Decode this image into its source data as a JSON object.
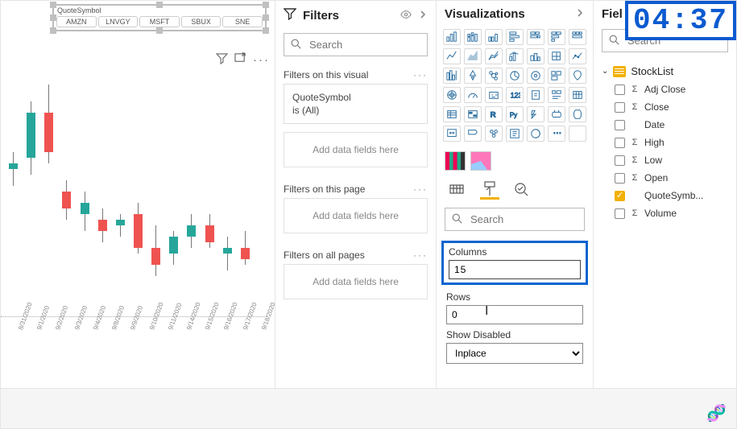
{
  "timer": "04:37",
  "slicer": {
    "title": "QuoteSymbol",
    "chips": [
      "AMZN",
      "LNVGY",
      "MSFT",
      "SBUX",
      "SNE"
    ]
  },
  "chart_data": {
    "type": "candlestick",
    "categories": [
      "8/31/2020",
      "9/1/2020",
      "9/2/2020",
      "9/3/2020",
      "9/4/2020",
      "9/8/2020",
      "9/9/2020",
      "9/10/2020",
      "9/11/2020",
      "9/14/2020",
      "9/15/2020",
      "9/16/2020",
      "9/17/2020",
      "9/18/2020"
    ],
    "series": [
      {
        "open": 103,
        "high": 106,
        "low": 100,
        "close": 104,
        "color": "green"
      },
      {
        "open": 105,
        "high": 115,
        "low": 102,
        "close": 113,
        "color": "green"
      },
      {
        "open": 113,
        "high": 118,
        "low": 104,
        "close": 106,
        "color": "red"
      },
      {
        "open": 99,
        "high": 101,
        "low": 94,
        "close": 96,
        "color": "red"
      },
      {
        "open": 95,
        "high": 99,
        "low": 92,
        "close": 97,
        "color": "green"
      },
      {
        "open": 94,
        "high": 96,
        "low": 90,
        "close": 92,
        "color": "red"
      },
      {
        "open": 93,
        "high": 95,
        "low": 91,
        "close": 94,
        "color": "green"
      },
      {
        "open": 95,
        "high": 97,
        "low": 88,
        "close": 89,
        "color": "red"
      },
      {
        "open": 89,
        "high": 93,
        "low": 84,
        "close": 86,
        "color": "red"
      },
      {
        "open": 88,
        "high": 92,
        "low": 86,
        "close": 91,
        "color": "green"
      },
      {
        "open": 91,
        "high": 95,
        "low": 89,
        "close": 93,
        "color": "green"
      },
      {
        "open": 93,
        "high": 95,
        "low": 89,
        "close": 90,
        "color": "red"
      },
      {
        "open": 88,
        "high": 91,
        "low": 85,
        "close": 89,
        "color": "green"
      },
      {
        "open": 89,
        "high": 92,
        "low": 86,
        "close": 87,
        "color": "red"
      }
    ],
    "ylim": [
      80,
      120
    ]
  },
  "filters": {
    "title": "Filters",
    "search_ph": "Search",
    "visual_label": "Filters on this visual",
    "page_label": "Filters on this page",
    "all_label": "Filters on all pages",
    "add_hint": "Add data fields here",
    "card_field": "QuoteSymbol",
    "card_state": "is (All)"
  },
  "viz": {
    "title": "Visualizations",
    "search_ph": "Search",
    "columns_label": "Columns",
    "columns_value": "15",
    "rows_label": "Rows",
    "rows_value": "0",
    "showdisabled_label": "Show Disabled",
    "showdisabled_value": "Inplace"
  },
  "fields": {
    "title": "Fiel",
    "search_ph": "Search",
    "table": "StockList",
    "cols": [
      {
        "name": "Adj Close",
        "sigma": true,
        "checked": false
      },
      {
        "name": "Close",
        "sigma": true,
        "checked": false
      },
      {
        "name": "Date",
        "sigma": false,
        "checked": false
      },
      {
        "name": "High",
        "sigma": true,
        "checked": false
      },
      {
        "name": "Low",
        "sigma": true,
        "checked": false
      },
      {
        "name": "Open",
        "sigma": true,
        "checked": false
      },
      {
        "name": "QuoteSymb...",
        "sigma": false,
        "checked": true
      },
      {
        "name": "Volume",
        "sigma": true,
        "checked": false
      }
    ]
  }
}
